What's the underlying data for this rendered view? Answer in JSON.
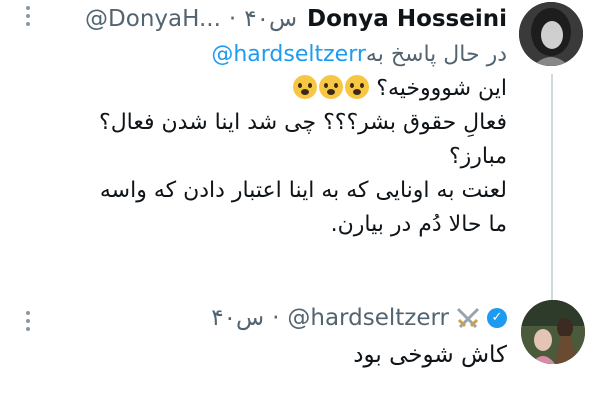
{
  "tweet": {
    "name": "Donya Hosseini",
    "handle": "@DonyaH...",
    "dot": "·",
    "time": "۴۰س",
    "reply_prefix": "در حال پاسخ به",
    "reply_to": "@hardseltzerr",
    "lines": [
      "این شوووخیه؟",
      "فعالِ حقوق بشر؟؟؟ چی شد اینا شدن فعال؟",
      "مبارز؟",
      "لعنت به اونایی که به اینا اعتبار دادن که واسه",
      "ما حالا دُم در بیارن."
    ],
    "emoji": [
      "face-screaming-emoji",
      "face-screaming-emoji",
      "face-screaming-emoji"
    ]
  },
  "reply": {
    "handle": "@hardseltzerr",
    "dot": "·",
    "time": "۴۰س",
    "text": "کاش شوخی بود"
  },
  "colors": {
    "link": "#1d9bf0",
    "muted": "#536471",
    "thread_line": "#cfd9de"
  }
}
